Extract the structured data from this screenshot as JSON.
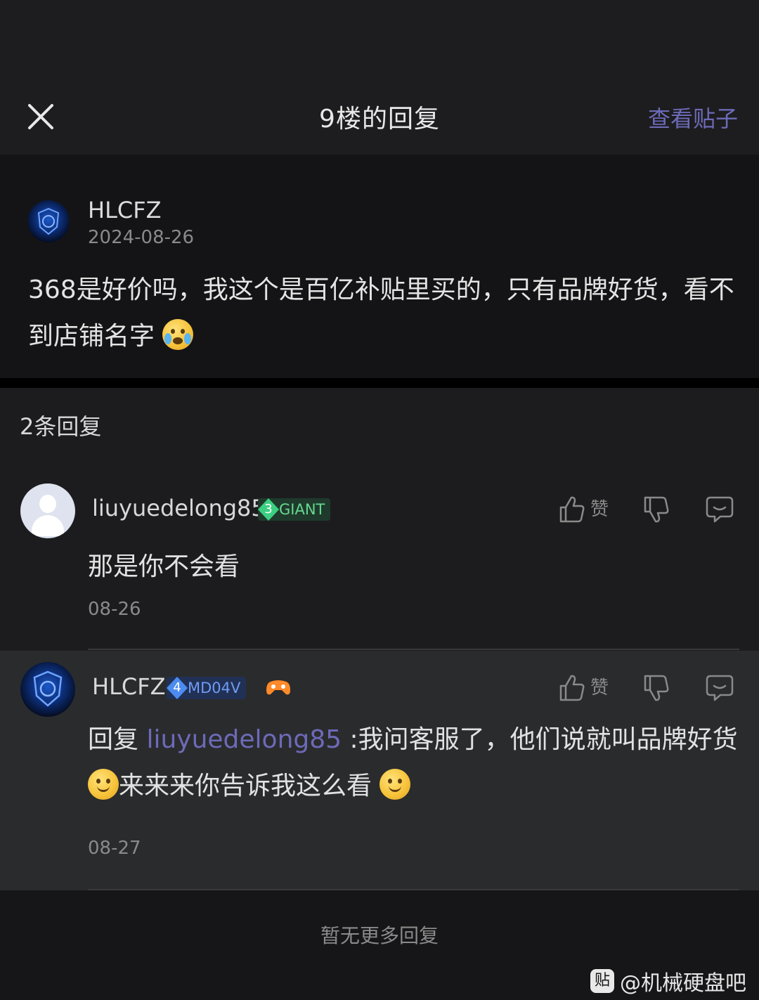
{
  "header": {
    "title": "9楼的回复",
    "view_post": "查看贴子"
  },
  "main_post": {
    "username": "HLCFZ",
    "date": "2024-08-26",
    "text": "368是好价吗，我这个是百亿补贴里买的，只有品牌好货，看不到店铺名字",
    "emoji": "crying-face-icon"
  },
  "replies_header": "2条回复",
  "replies": [
    {
      "username": "liuyuedelong85",
      "badge_level": "3",
      "badge_text": "GIANT",
      "like_label": "赞",
      "text": "那是你不会看",
      "time": "08-26"
    },
    {
      "username": "HLCFZ",
      "badge_level": "4",
      "badge_text": "MD04V",
      "like_label": "赞",
      "reply_prefix": "回复",
      "mention": "liuyuedelong85",
      "text_part1": ":我问客服了，他们说就叫品牌好货",
      "text_part2": "来来来你告诉我这么看",
      "time": "08-27"
    }
  ],
  "no_more": "暂无更多回复",
  "watermark": {
    "icon_text": "贴",
    "text": "@机械硬盘吧"
  },
  "colors": {
    "accent": "#6d6ab8",
    "badge_green": "#3ccf82",
    "badge_blue": "#4c8cf0"
  }
}
